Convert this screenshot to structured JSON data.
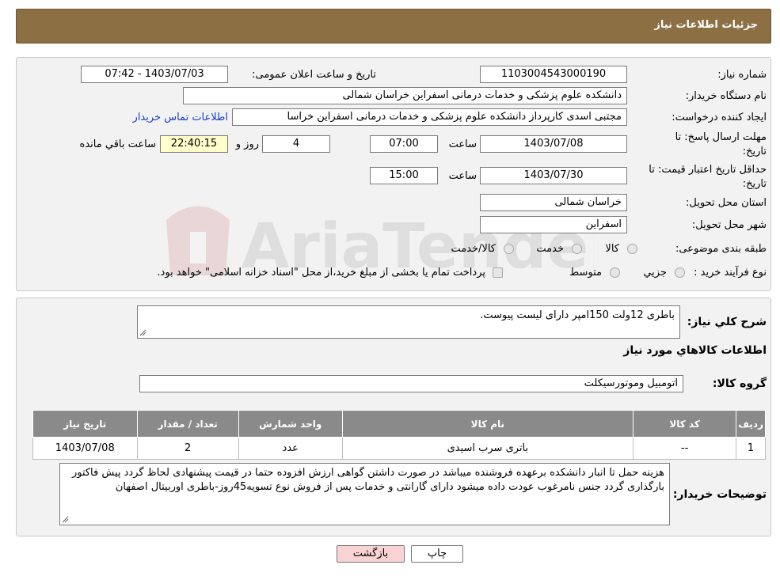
{
  "header": {
    "title": "جزئیات اطلاعات نیاز"
  },
  "form": {
    "need_number_label": "شماره نیاز:",
    "need_number": "1103004543000190",
    "announce_label": "تاریخ و ساعت اعلان عمومی:",
    "announce_value": "1403/07/03 - 07:42",
    "buyer_org_label": "نام دستگاه خریدار:",
    "buyer_org": "دانشکده علوم پزشکی و خدمات درمانی اسفراین خراسان شمالی",
    "creator_label": "ایجاد کننده درخواست:",
    "creator": "مجتبی اسدی کارپرداز  دانشکده علوم پزشکی و خدمات درمانی اسفراین خراسا",
    "contact_link": "اطلاعات تماس خریدار",
    "deadline_label_1": "مهلت ارسال پاسخ: تا",
    "deadline_label_2": "تاریخ:",
    "deadline_date": "1403/07/08",
    "time_label": "ساعت",
    "deadline_time": "07:00",
    "days_value": "4",
    "days_label": "روز و",
    "remaining_time": "22:40:15",
    "remaining_label": "ساعت باقي مانده",
    "validity_label_1": "حداقل تاریخ اعتبار قیمت: تا",
    "validity_label_2": "تاریخ:",
    "validity_date": "1403/07/30",
    "validity_time": "15:00",
    "province_label": "استان محل تحویل:",
    "province": "خراسان شمالی",
    "city_label": "شهر محل تحویل:",
    "city": "اسفراین",
    "category_label": "طبقه بندی موضوعی:",
    "category_options": [
      "کالا",
      "خدمت",
      "کالا/خدمت"
    ],
    "purchase_type_label": "نوع فرآیند خرید :",
    "purchase_type_options": [
      "جزيي",
      "متوسط"
    ],
    "payment_note": "پرداخت تمام یا بخشی از مبلغ خرید،از محل \"اسناد خزانه اسلامی\" خواهد بود."
  },
  "details": {
    "summary_label": "شرح کلي نياز:",
    "summary": "باطری 12ولت 150امپر دارای لیست پیوست.",
    "goods_info_title": "اطلاعات کالاهاي مورد نياز",
    "goods_group_label": "گروه کالا:",
    "goods_group": "اتومبیل وموتورسیکلت",
    "table": {
      "headers": [
        "رديف",
        "کد کالا",
        "نام کالا",
        "واحد شمارش",
        "تعداد / مقدار",
        "تاريخ نياز"
      ],
      "rows": [
        [
          "1",
          "--",
          "باتری سرب اسیدی",
          "عدد",
          "2",
          "1403/07/08"
        ]
      ]
    },
    "buyer_notes_label": "توضیحات خریدار:",
    "buyer_notes": "هزینه حمل تا انبار دانشکده برعهده فروشنده میباشد در صورت داشتن گواهی ارزش افزوده حتما در قیمت پیشنهادی لحاظ گردد پیش فاکتور بارگذاری گردد جنس نامرغوب عودت داده میشود دارای گارانتی و خدمات پس از فروش نوع تسویه45روز-باطری اوربیتال اصفهان"
  },
  "buttons": {
    "print": "چاپ",
    "back": "بازگشت"
  },
  "colors": {
    "header": "#8d6f44",
    "back_button": "#f9d3d3",
    "link": "#1a3ec9"
  },
  "watermark": {
    "text": "AriaTender.neT"
  }
}
